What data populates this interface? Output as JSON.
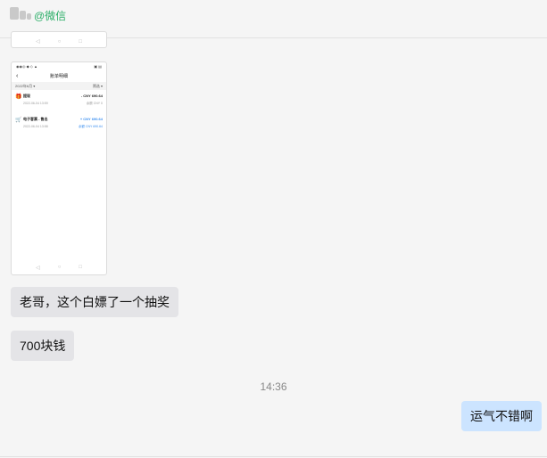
{
  "header": {
    "title": "@微信"
  },
  "screenshot": {
    "status_left": "◉◉◎ ◆ ◇ ▲",
    "status_right": "▣ ▤",
    "title": "账单明细",
    "month": "2022年6月 ▾",
    "filter": "筛选 ▾",
    "transactions": [
      {
        "icon": "gift-icon",
        "name": "提现",
        "amount": "- CNY 690.64",
        "date": "2022-06-04 13:59",
        "balance": "余额 CNY 0"
      },
      {
        "icon": "cart-icon",
        "name": "电子客票 - 售出",
        "amount": "+ CNY 690.64",
        "date": "2022-06-04 13:58",
        "balance": "余额 CNY 690.64"
      }
    ],
    "nav": [
      "◁",
      "○",
      "□"
    ]
  },
  "messages": [
    {
      "text": "老哥，这个白嫖了一个抽奖",
      "side": "in"
    },
    {
      "text": "700块钱",
      "side": "in"
    },
    {
      "text": "运气不错啊",
      "side": "out"
    }
  ],
  "timestamp": "14:36",
  "colors": {
    "accent": "#2aae67",
    "bubble_in": "#e4e4e7",
    "bubble_out": "#cce4ff",
    "link_blue": "#3b8ff0"
  }
}
